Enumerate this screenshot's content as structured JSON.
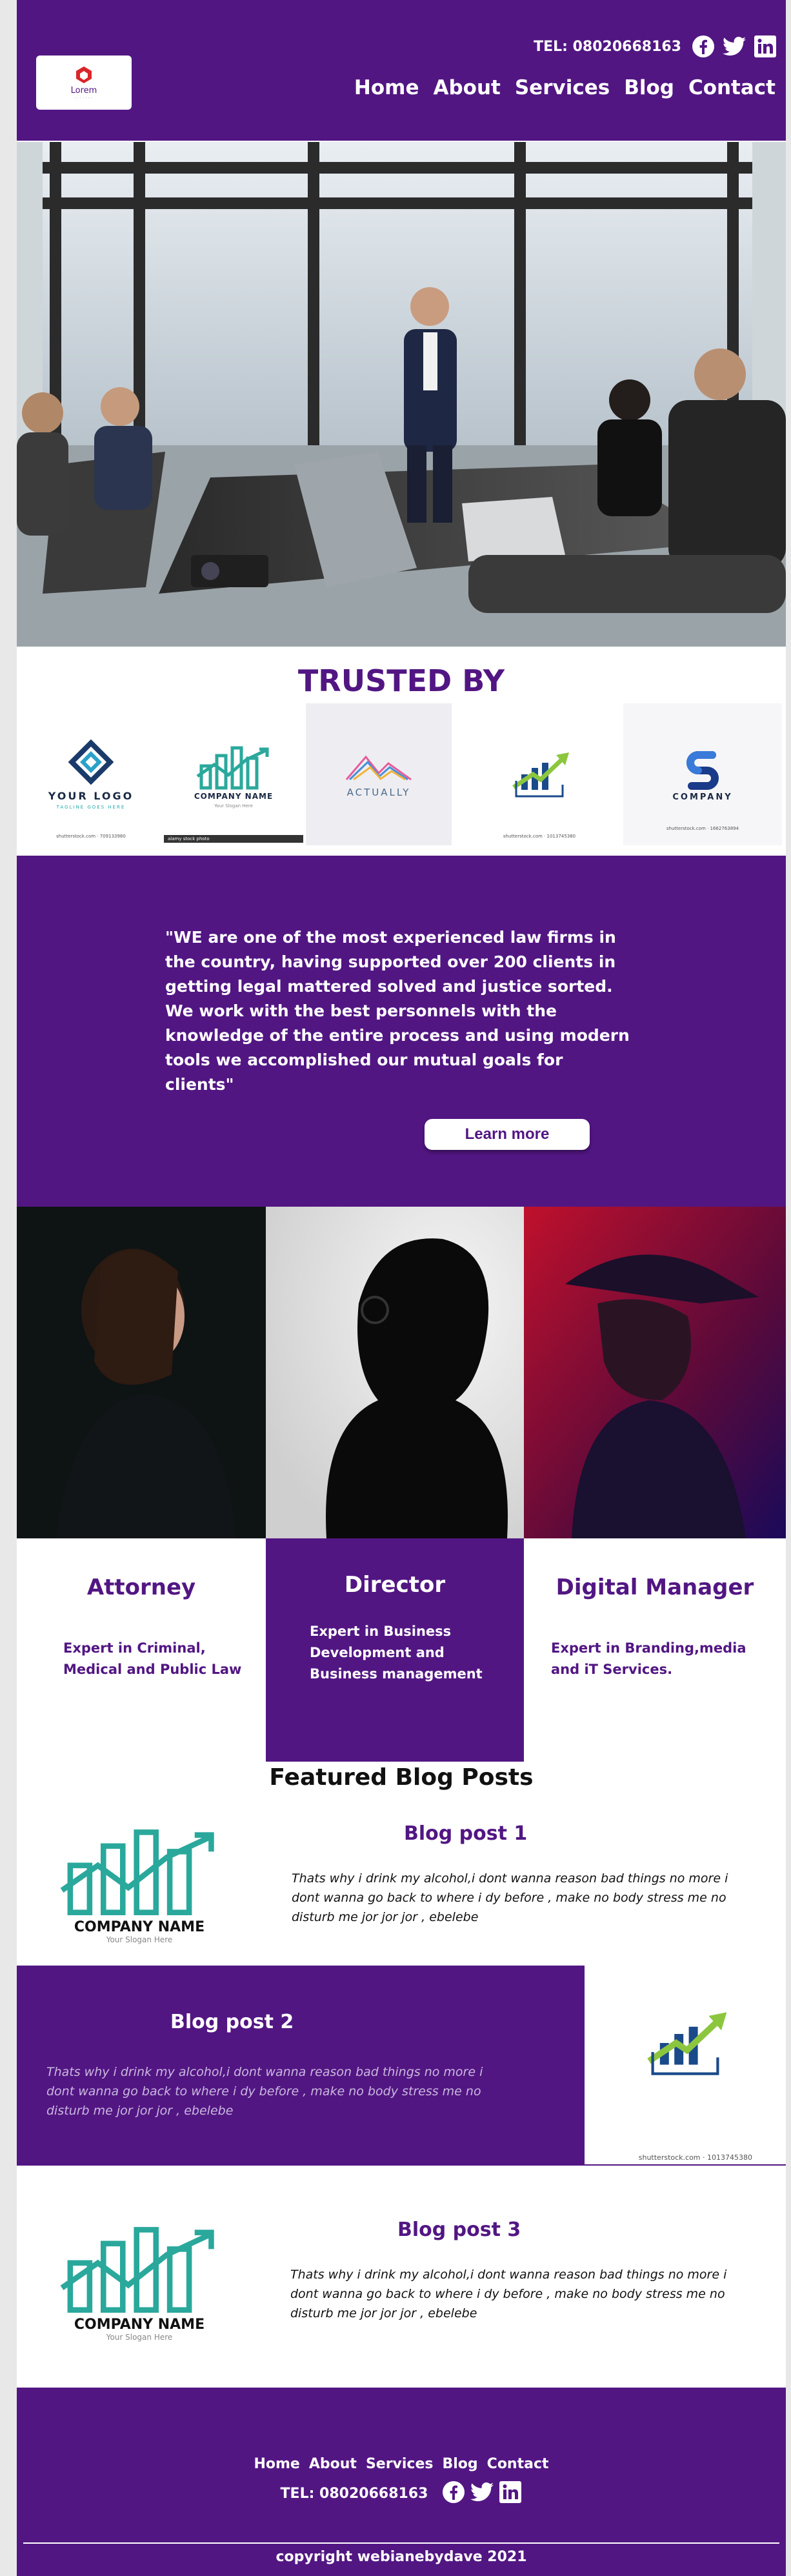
{
  "header": {
    "logo_text": "Lorem",
    "tel": "TEL: 08020668163",
    "nav": [
      "Home",
      "About",
      "Services",
      "Blog",
      "Contact"
    ],
    "social_icons": [
      "facebook-icon",
      "twitter-icon",
      "linkedin-icon"
    ]
  },
  "trusted": {
    "title": "TRUSTED BY",
    "brands": [
      {
        "name": "YOUR LOGO",
        "sub": "TAGLINE GOES HERE",
        "foot": "shutterstock.com · 709133980"
      },
      {
        "name": "COMPANY NAME",
        "sub": "Your Slogan Here",
        "foot": "alamy stock photo"
      },
      {
        "name": "ACTUALLY",
        "sub": "",
        "foot": ""
      },
      {
        "name": "",
        "sub": "",
        "foot": "shutterstock.com · 1013745380"
      },
      {
        "name": "COMPANY",
        "sub": "",
        "foot": "shutterstock.com · 1662763894"
      }
    ]
  },
  "quote": {
    "text": "\"WE are one of the most experienced law firms in the country, having supported over 200 clients in getting legal mattered solved and justice sorted. We work with the best personnels with the knowledge of the entire process and using modern tools we accomplished our mutual goals for clients\"",
    "button": "Learn more"
  },
  "team": [
    {
      "title": "Attorney",
      "desc": "Expert in Criminal, Medical and Public Law"
    },
    {
      "title": "Director",
      "desc": "Expert in Business Development and Business management"
    },
    {
      "title": "Digital Manager",
      "desc": "Expert in Branding,media and iT Services."
    }
  ],
  "blog": {
    "heading": "Featured Blog Posts",
    "posts": [
      {
        "title": "Blog post 1",
        "text": "Thats  why i drink my alcohol,i dont wanna reason bad things no more i dont wanna go back to where i dy before , make no body stress me no disturb me jor jor jor , ebelebe"
      },
      {
        "title": "Blog post 2",
        "text": "Thats  why i drink my alcohol,i dont wanna reason bad things no more i dont wanna go back to where i dy before , make no body stress me no disturb me jor jor jor , ebelebe"
      },
      {
        "title": "Blog post 3",
        "text": "Thats  why i drink my alcohol,i dont wanna reason bad things no more i dont wanna go back to where i dy before , make no body stress me no disturb me jor jor jor , ebelebe"
      }
    ],
    "company_name": "COMPANY NAME",
    "company_slogan": "Your Slogan Here",
    "shutter_caption": "shutterstock.com · 1013745380"
  },
  "footer": {
    "nav": [
      "Home",
      "About",
      "Services",
      "Blog",
      "Contact"
    ],
    "tel": "TEL: 08020668163",
    "copyright": "copyright webianebydave 2021"
  },
  "colors": {
    "brand": "#521683",
    "teal": "#2aa89c",
    "white": "#ffffff"
  }
}
